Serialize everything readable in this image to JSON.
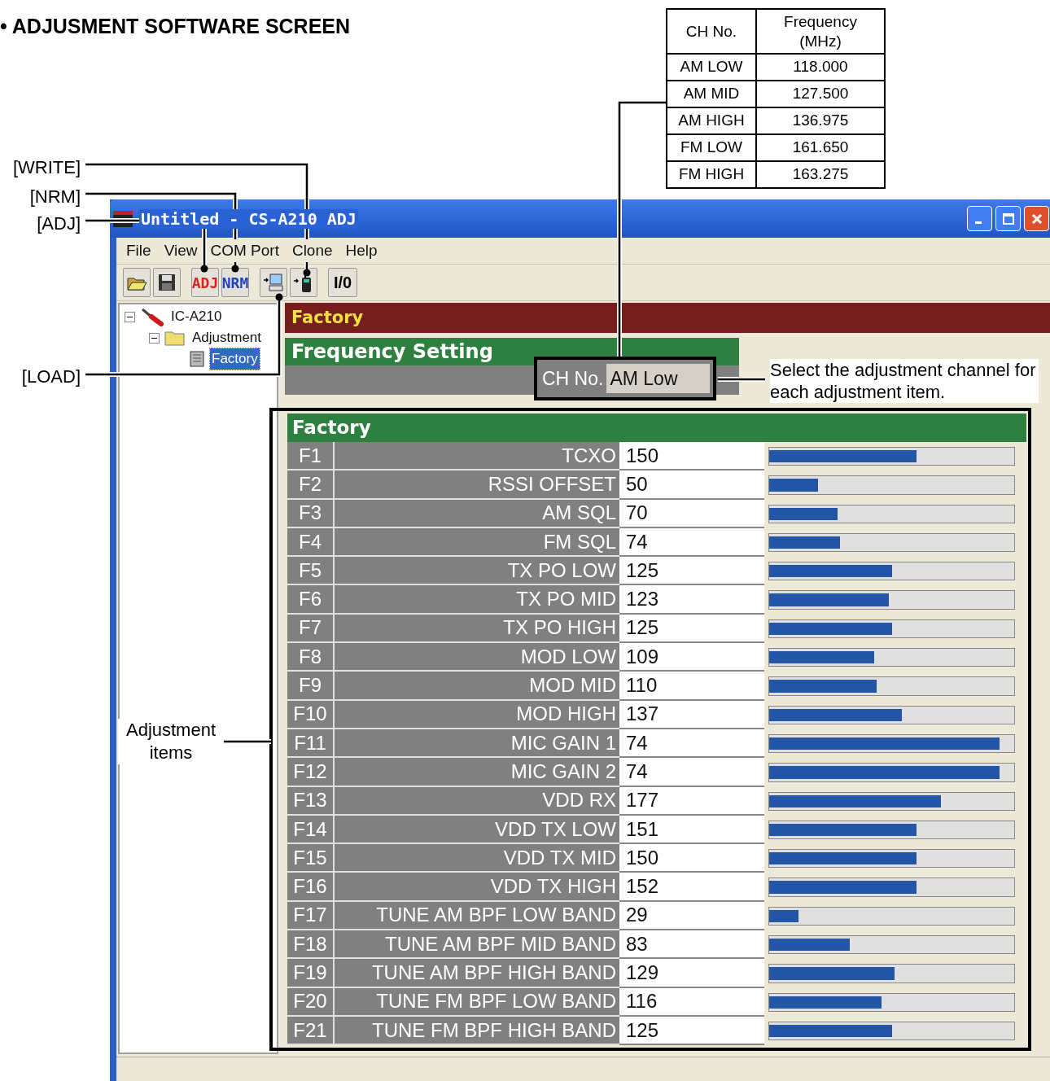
{
  "heading": "• ADJUSMENT SOFTWARE SCREEN",
  "frequency_table": {
    "columns": [
      "CH No.",
      "Frequency\n(MHz)"
    ],
    "rows": [
      [
        "AM LOW",
        "118.000"
      ],
      [
        "AM MID",
        "127.500"
      ],
      [
        "AM HIGH",
        "136.975"
      ],
      [
        "FM LOW",
        "161.650"
      ],
      [
        "FM HIGH",
        "163.275"
      ]
    ]
  },
  "callouts": [
    {
      "kind": "write",
      "text": "[WRITE]"
    },
    {
      "kind": "nrm",
      "text": "[NRM]"
    },
    {
      "kind": "adj",
      "text": "[ADJ]"
    },
    {
      "kind": "load",
      "text": "[LOAD]"
    },
    {
      "kind": "items",
      "text": "Adjustment items"
    },
    {
      "kind": "channel",
      "text": "Select the adjustment channel for each adjustment item."
    }
  ],
  "window": {
    "title": "Untitled - CS-A210 ADJ",
    "menu": [
      "File",
      "View",
      "COM Port",
      "Clone",
      "Help"
    ],
    "toolbar": [
      {
        "kind": "open"
      },
      {
        "kind": "save"
      },
      {
        "kind": "adj",
        "label": "ADJ"
      },
      {
        "kind": "nrm",
        "label": "NRM"
      },
      {
        "kind": "load"
      },
      {
        "kind": "write"
      },
      {
        "kind": "io",
        "label": "I/0"
      }
    ],
    "tree": [
      {
        "label": "IC-A210",
        "kind": "radio",
        "expanded": true,
        "selected": false,
        "children": [
          {
            "label": "Adjustment",
            "kind": "folder",
            "expanded": true,
            "selected": false,
            "children": [
              {
                "label": "Factory",
                "kind": "sheet",
                "selected": true
              }
            ]
          }
        ]
      }
    ],
    "page_header": "Factory",
    "frequency_setting": {
      "title": "Frequency Setting",
      "ch_label": "CH No.",
      "ch_value": "AM Low"
    },
    "adjustment": {
      "title": "Factory",
      "rows": [
        {
          "id": "F1",
          "name": "TCXO",
          "value": "150",
          "level": 0.6
        },
        {
          "id": "F2",
          "name": "RSSI OFFSET",
          "value": "50",
          "level": 0.2
        },
        {
          "id": "F3",
          "name": "AM SQL",
          "value": "70",
          "level": 0.28
        },
        {
          "id": "F4",
          "name": "FM SQL",
          "value": "74",
          "level": 0.29
        },
        {
          "id": "F5",
          "name": "TX PO LOW",
          "value": "125",
          "level": 0.5
        },
        {
          "id": "F6",
          "name": "TX PO MID",
          "value": "123",
          "level": 0.49
        },
        {
          "id": "F7",
          "name": "TX PO HIGH",
          "value": "125",
          "level": 0.5
        },
        {
          "id": "F8",
          "name": "MOD LOW",
          "value": "109",
          "level": 0.43
        },
        {
          "id": "F9",
          "name": "MOD MID",
          "value": "110",
          "level": 0.44
        },
        {
          "id": "F10",
          "name": "MOD HIGH",
          "value": "137",
          "level": 0.54
        },
        {
          "id": "F11",
          "name": "MIC GAIN 1",
          "value": "74",
          "level": 0.94
        },
        {
          "id": "F12",
          "name": "MIC GAIN 2",
          "value": "74",
          "level": 0.94
        },
        {
          "id": "F13",
          "name": "VDD RX",
          "value": "177",
          "level": 0.7
        },
        {
          "id": "F14",
          "name": "VDD TX LOW",
          "value": "151",
          "level": 0.6
        },
        {
          "id": "F15",
          "name": "VDD TX MID",
          "value": "150",
          "level": 0.6
        },
        {
          "id": "F16",
          "name": "VDD TX HIGH",
          "value": "152",
          "level": 0.6
        },
        {
          "id": "F17",
          "name": "TUNE AM BPF LOW BAND",
          "value": "29",
          "level": 0.12
        },
        {
          "id": "F18",
          "name": "TUNE AM BPF MID BAND",
          "value": "83",
          "level": 0.33
        },
        {
          "id": "F19",
          "name": "TUNE AM BPF HIGH BAND",
          "value": "129",
          "level": 0.51
        },
        {
          "id": "F20",
          "name": "TUNE FM BPF LOW BAND",
          "value": "116",
          "level": 0.46
        },
        {
          "id": "F21",
          "name": "TUNE FM BPF HIGH BAND",
          "value": "125",
          "level": 0.5
        }
      ]
    }
  }
}
